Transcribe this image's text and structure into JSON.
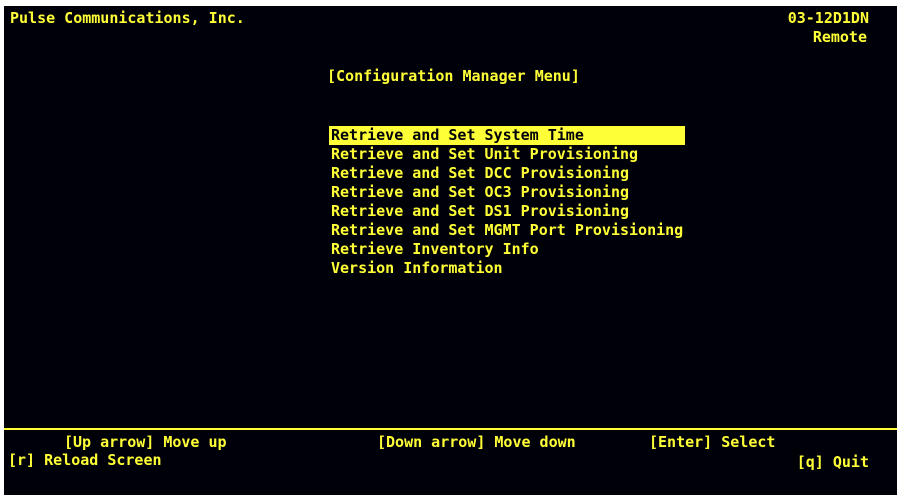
{
  "header": {
    "company": "Pulse Communications, Inc.",
    "model": "03-12D1DN",
    "mode": "Remote"
  },
  "menu": {
    "title": "[Configuration Manager Menu]",
    "selected_index": 0,
    "items": [
      {
        "label": "Retrieve and Set System Time"
      },
      {
        "label": "Retrieve and Set Unit Provisioning"
      },
      {
        "label": "Retrieve and Set DCC Provisioning"
      },
      {
        "label": "Retrieve and Set OC3 Provisioning"
      },
      {
        "label": "Retrieve and Set DS1 Provisioning"
      },
      {
        "label": "Retrieve and Set MGMT Port Provisioning"
      },
      {
        "label": "Retrieve Inventory Info"
      },
      {
        "label": "Version Information"
      }
    ]
  },
  "footer": {
    "hint_up": "[Up arrow] Move up",
    "hint_down": "[Down arrow] Move down",
    "hint_enter": "[Enter] Select",
    "key_reload": "[r] Reload Screen",
    "key_quit": "[q] Quit"
  },
  "colors": {
    "background": "#000008",
    "foreground": "#ffff37",
    "page": "#ffffff"
  }
}
